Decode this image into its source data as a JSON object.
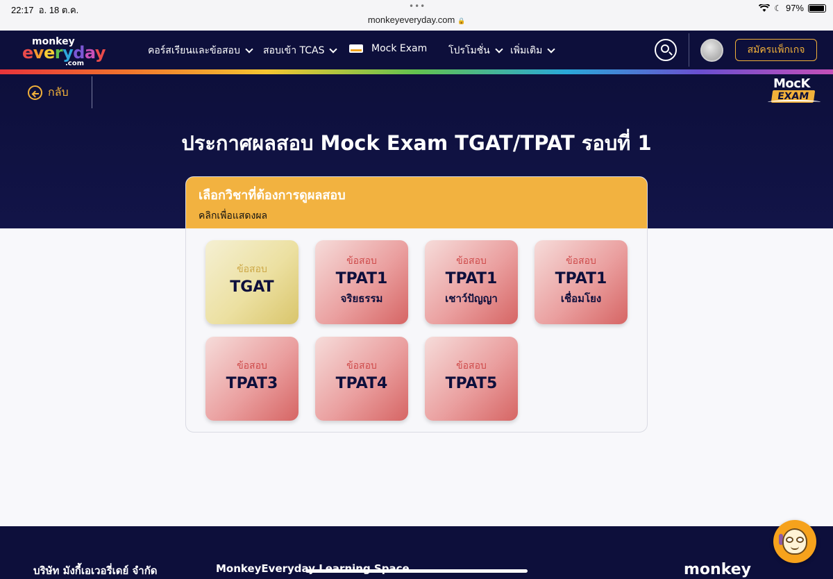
{
  "status_bar": {
    "time": "22:17",
    "date": "อ. 18 ต.ค.",
    "url": "monkeyeveryday.com",
    "battery": "97%"
  },
  "header": {
    "logo_top": "monkey",
    "logo_main": "everyday",
    "logo_sub": ".com",
    "menu": [
      {
        "label": "คอร์สเรียนและข้อสอบ"
      },
      {
        "label": "สอบเข้า TCAS"
      },
      {
        "label": "Mock Exam"
      },
      {
        "label": "โปรโมชั่น"
      },
      {
        "label": "เพิ่มเติม"
      }
    ],
    "signup_label": "สมัครแพ็กเกจ"
  },
  "hero": {
    "back_label": "กลับ",
    "mock_logo_top": "MocK",
    "mock_logo_bottom": "EXAM",
    "title": "ประกาศผลสอบ Mock Exam TGAT/TPAT รอบที่ 1"
  },
  "panel": {
    "title": "เลือกวิชาที่ต้องการดูผลสอบ",
    "subtitle": "คลิกเพื่อแสดงผล",
    "cards": [
      {
        "kicker": "ข้อสอบ",
        "name": "TGAT",
        "sub": ""
      },
      {
        "kicker": "ข้อสอบ",
        "name": "TPAT1",
        "sub": "จริยธรรม"
      },
      {
        "kicker": "ข้อสอบ",
        "name": "TPAT1",
        "sub": "เชาว์ปัญญา"
      },
      {
        "kicker": "ข้อสอบ",
        "name": "TPAT1",
        "sub": "เชื่อมโยง"
      },
      {
        "kicker": "ข้อสอบ",
        "name": "TPAT3",
        "sub": ""
      },
      {
        "kicker": "ข้อสอบ",
        "name": "TPAT4",
        "sub": ""
      },
      {
        "kicker": "ข้อสอบ",
        "name": "TPAT5",
        "sub": ""
      }
    ]
  },
  "footer": {
    "company": "บริษัท มังกี้เอเวอรี่เดย์ จำกัด",
    "space": "MonkeyEveryday Learning Space",
    "logo": "monkey"
  },
  "colors": {
    "navy": "#0d0f3b",
    "accent_gold": "#f2b13a",
    "card_red": "#d66564",
    "card_gold": "#d9c56b"
  },
  "icons": [
    "back-arrow-icon",
    "search-icon",
    "chevron-down-icon",
    "wifi-icon",
    "moon-icon",
    "battery-icon",
    "lock-icon",
    "chat-mascot-icon"
  ]
}
